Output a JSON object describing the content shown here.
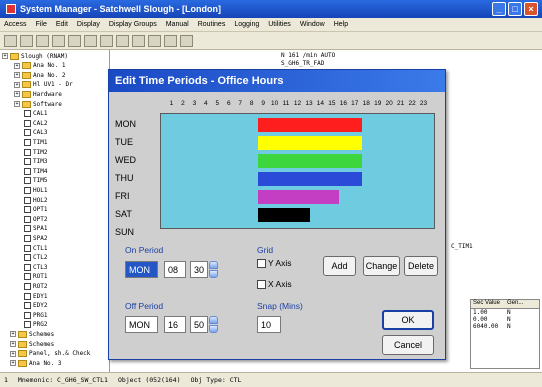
{
  "app": {
    "title": "System Manager - Satchwell Slough - [London]",
    "window_buttons": [
      "_",
      "□",
      "×"
    ]
  },
  "menu": [
    "Access",
    "File",
    "Edit",
    "Display",
    "Display Groups",
    "Manual",
    "Routines",
    "Logging",
    "Utilities",
    "Window",
    "Help"
  ],
  "tree": [
    {
      "label": "Slough (RNAM)",
      "type": "folder"
    },
    {
      "label": "Ana No. 1",
      "type": "folder"
    },
    {
      "label": "Ana No. 2",
      "type": "folder"
    },
    {
      "label": "Hl UV1 - Dr",
      "type": "folder"
    },
    {
      "label": "Hardware",
      "type": "folder"
    },
    {
      "label": "Software",
      "type": "folder"
    },
    {
      "label": "CAL1",
      "type": "leaf"
    },
    {
      "label": "CAL2",
      "type": "leaf"
    },
    {
      "label": "CAL3",
      "type": "leaf"
    },
    {
      "label": "TIM1",
      "type": "leaf"
    },
    {
      "label": "TIM2",
      "type": "leaf"
    },
    {
      "label": "TIM3",
      "type": "leaf"
    },
    {
      "label": "TIM4",
      "type": "leaf"
    },
    {
      "label": "TIM5",
      "type": "leaf"
    },
    {
      "label": "HOL1",
      "type": "leaf"
    },
    {
      "label": "HOL2",
      "type": "leaf"
    },
    {
      "label": "OPT1",
      "type": "leaf"
    },
    {
      "label": "OPT2",
      "type": "leaf"
    },
    {
      "label": "SPA1",
      "type": "leaf"
    },
    {
      "label": "SPA2",
      "type": "leaf"
    },
    {
      "label": "CTL1",
      "type": "leaf"
    },
    {
      "label": "CTL2",
      "type": "leaf"
    },
    {
      "label": "CTL3",
      "type": "leaf"
    },
    {
      "label": "ROT1",
      "type": "leaf"
    },
    {
      "label": "ROT2",
      "type": "leaf"
    },
    {
      "label": "EDY1",
      "type": "leaf"
    },
    {
      "label": "EDY2",
      "type": "leaf"
    },
    {
      "label": "PRG1",
      "type": "leaf"
    },
    {
      "label": "PRG2",
      "type": "leaf"
    },
    {
      "label": "Schemes",
      "type": "folder"
    },
    {
      "label": "Schemes",
      "type": "folder"
    },
    {
      "label": "Panel, sh.& Check",
      "type": "folder"
    },
    {
      "label": "Ana No. 3",
      "type": "folder"
    }
  ],
  "right_pane": {
    "header_line": "N     161 /min                        AUTO",
    "sub_line": "S_GH6_TR_FAD",
    "ctl_ref": "C_TIM1"
  },
  "value_table": {
    "headers": [
      "Sec Value",
      "Gen..."
    ],
    "rows": [
      [
        "1.00",
        "N"
      ],
      [
        "0.00",
        "N"
      ],
      [
        "6040.00",
        "N"
      ]
    ]
  },
  "status": {
    "left": "1",
    "mnemonic": "Mnemonic: C_GH6_SW_CTL1",
    "object": "Object (052(164)",
    "obj_type": "Obj Type: CTL"
  },
  "dialog": {
    "title": "Edit Time Periods - Office Hours",
    "hours": [
      "1",
      "2",
      "3",
      "4",
      "5",
      "6",
      "7",
      "8",
      "9",
      "10",
      "11",
      "12",
      "13",
      "14",
      "15",
      "16",
      "17",
      "18",
      "19",
      "20",
      "21",
      "22",
      "23"
    ],
    "days": [
      "MON",
      "TUE",
      "WED",
      "THU",
      "FRI",
      "SAT",
      "SUN"
    ],
    "periods": [
      {
        "day": "MON",
        "start": 8.5,
        "end": 17.5,
        "color": "#ff1e1e"
      },
      {
        "day": "TUE",
        "start": 8.5,
        "end": 17.5,
        "color": "#ffff00"
      },
      {
        "day": "WED",
        "start": 8.5,
        "end": 17.5,
        "color": "#3ed63e"
      },
      {
        "day": "THU",
        "start": 8.5,
        "end": 17.5,
        "color": "#2b4ad8"
      },
      {
        "day": "FRI",
        "start": 8.5,
        "end": 15.5,
        "color": "#c43ec4"
      },
      {
        "day": "SAT",
        "start": 8.5,
        "end": 13.0,
        "color": "#000000"
      }
    ],
    "on_period": {
      "label": "On Period",
      "day": "MON",
      "hour": "08",
      "minute": "30"
    },
    "off_period": {
      "label": "Off Period",
      "day": "MON",
      "hour": "16",
      "minute": "50"
    },
    "grid": {
      "label": "Grid",
      "y_axis": "Y Axis",
      "x_axis": "X Axis",
      "y_checked": false,
      "x_checked": false
    },
    "snap": {
      "label": "Snap (Mins)",
      "value": "10"
    },
    "buttons": {
      "add": "Add",
      "change": "Change",
      "delete": "Delete",
      "ok": "OK",
      "cancel": "Cancel"
    }
  }
}
